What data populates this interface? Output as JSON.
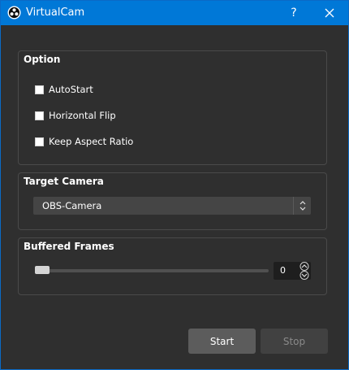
{
  "window": {
    "title": "VirtualCam",
    "help_label": "?"
  },
  "option_group": {
    "title": "Option",
    "checkboxes": [
      {
        "label": "AutoStart",
        "checked": false
      },
      {
        "label": "Horizontal Flip",
        "checked": false
      },
      {
        "label": "Keep Aspect Ratio",
        "checked": false
      }
    ]
  },
  "target_camera_group": {
    "title": "Target Camera",
    "selected": "OBS-Camera"
  },
  "buffered_frames_group": {
    "title": "Buffered Frames",
    "value": "0",
    "slider_fraction": 0
  },
  "buttons": {
    "start_label": "Start",
    "stop_label": "Stop"
  },
  "colors": {
    "titlebar": "#0078d7",
    "window_bg": "#2f2f2f"
  }
}
